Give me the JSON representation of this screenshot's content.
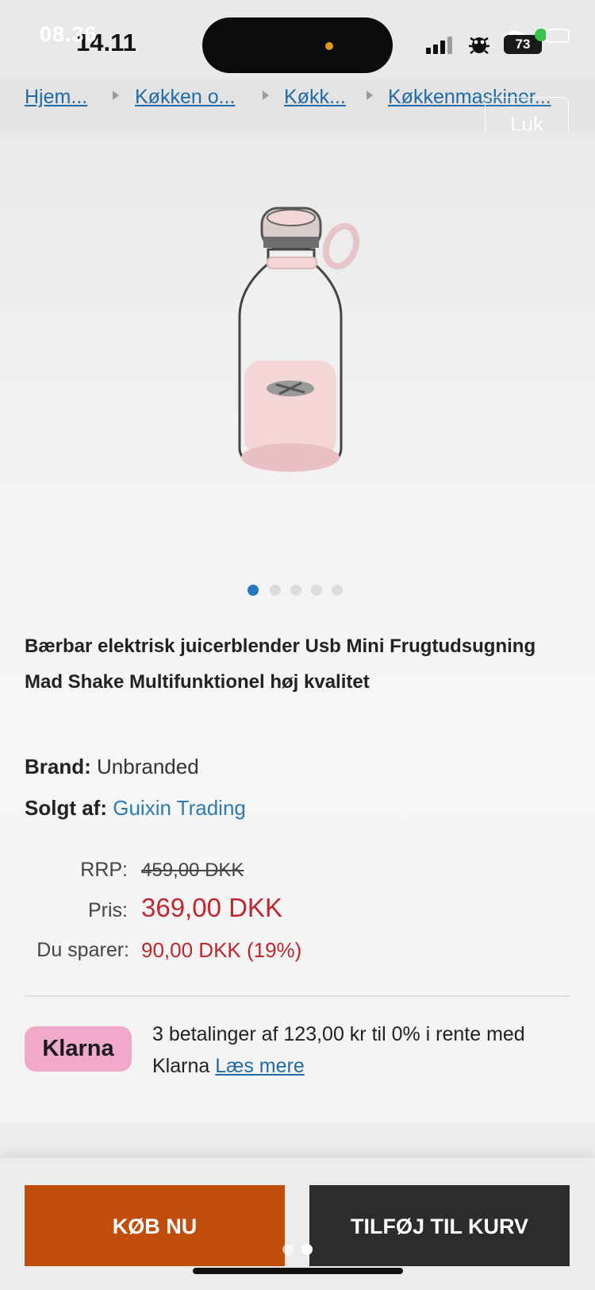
{
  "status": {
    "time_overlay": "08.36",
    "time": "14.11",
    "battery": "73"
  },
  "breadcrumb": [
    "Hjem...",
    "Køkken o...",
    "Køkk...",
    "Køkkenmaskiner..."
  ],
  "close_label": "Luk",
  "product": {
    "title": "Bærbar elektrisk juicerblender Usb Mini Frugtudsugning Mad Shake Multifunktionel høj kvalitet",
    "brand_label": "Brand:",
    "brand": "Unbranded",
    "seller_label": "Solgt af:",
    "seller": "Guixin Trading",
    "image_count": 5,
    "active_image": 1
  },
  "pricing": {
    "rrp_label": "RRP:",
    "rrp": "459,00 DKK",
    "price_label": "Pris:",
    "price": "369,00 DKK",
    "save_label": "Du sparer:",
    "save": "90,00 DKK (19%)"
  },
  "klarna": {
    "badge": "Klarna",
    "text": "3 betalinger af 123,00 kr til 0% i rente med Klarna",
    "link": "Læs mere"
  },
  "actions": {
    "buy": "KØB NU",
    "add_to_cart": "TILFØJ TIL KURV"
  },
  "colors": {
    "accent_link": "#1f6aa8",
    "price_red": "#c0262e",
    "buy_orange": "#c24d0a",
    "cart_dark": "#2b2c2e",
    "klarna_pink": "#f1a9c9"
  }
}
